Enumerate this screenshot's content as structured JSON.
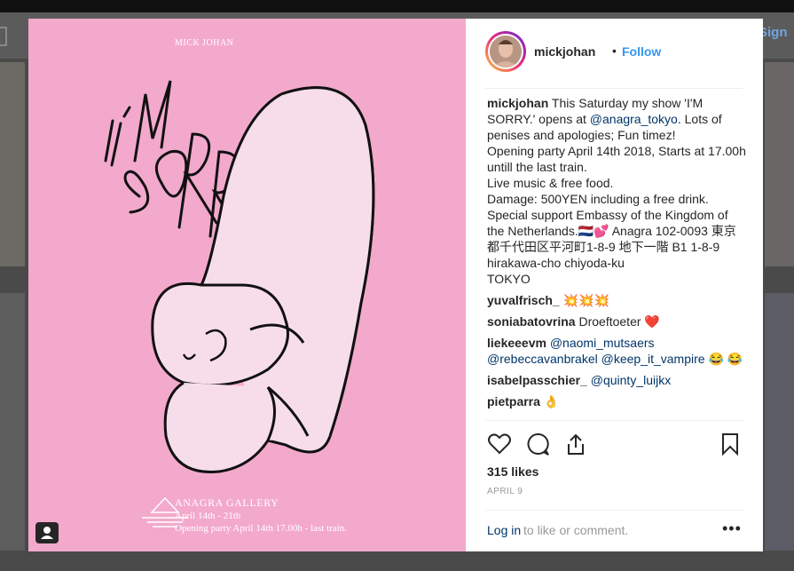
{
  "background": {
    "sign_in_label": "Sign"
  },
  "post_image": {
    "artist": "MICK JOHAN",
    "headline": "I'M SORRY",
    "gallery_name": "ANAGRA GALLERY",
    "dates": "April 14th - 21th",
    "opening": "Opening party April 14th 17.00h - last train."
  },
  "header": {
    "username": "mickjohan",
    "separator": "•",
    "follow_label": "Follow"
  },
  "caption": {
    "username": "mickjohan",
    "parts": [
      "This Saturday my show 'I'M SORRY.' opens at ",
      "@anagra_tokyo",
      ". Lots of penises and apologies; Fun timez!"
    ],
    "lines": [
      "Opening party April 14th 2018,  Starts at 17.00h untill the last train.",
      "Live music & free food.",
      "Damage: 500YEN including a free drink.",
      "Special support Embassy of the Kingdom of the Netherlands.🇳🇱💕 Anagra 102-0093 東京都千代田区平河町1-8-9 地下一階 B1 1-8-9 hirakawa-cho chiyoda-ku",
      "TOKYO"
    ]
  },
  "comments": [
    {
      "user": "yuvalfrisch_",
      "text": "💥💥💥"
    },
    {
      "user": "soniabatovrina",
      "text": "Droeftoeter ❤️"
    },
    {
      "user": "liekeeevm",
      "mention1": "@naomi_mutsaers",
      "mention2": "@rebeccavanbrakel",
      "mention3": "@keep_it_vampire",
      "emoji": "😂 😂"
    },
    {
      "user": "isabelpasschier_",
      "mention1": "@quinty_luijkx"
    },
    {
      "user": "pietparra",
      "text": "👌"
    }
  ],
  "actions": {
    "like_icon": "heart-icon",
    "comment_icon": "comment-icon",
    "share_icon": "share-icon",
    "save_icon": "bookmark-icon"
  },
  "likes_label": "315 likes",
  "date_label": "APRIL 9",
  "footer": {
    "login_label": "Log in",
    "login_rest": "to like or comment.",
    "more_label": "•••"
  },
  "colors": {
    "pink_background": "#f3a9cc",
    "link": "#3897f0",
    "mention": "#003569"
  }
}
